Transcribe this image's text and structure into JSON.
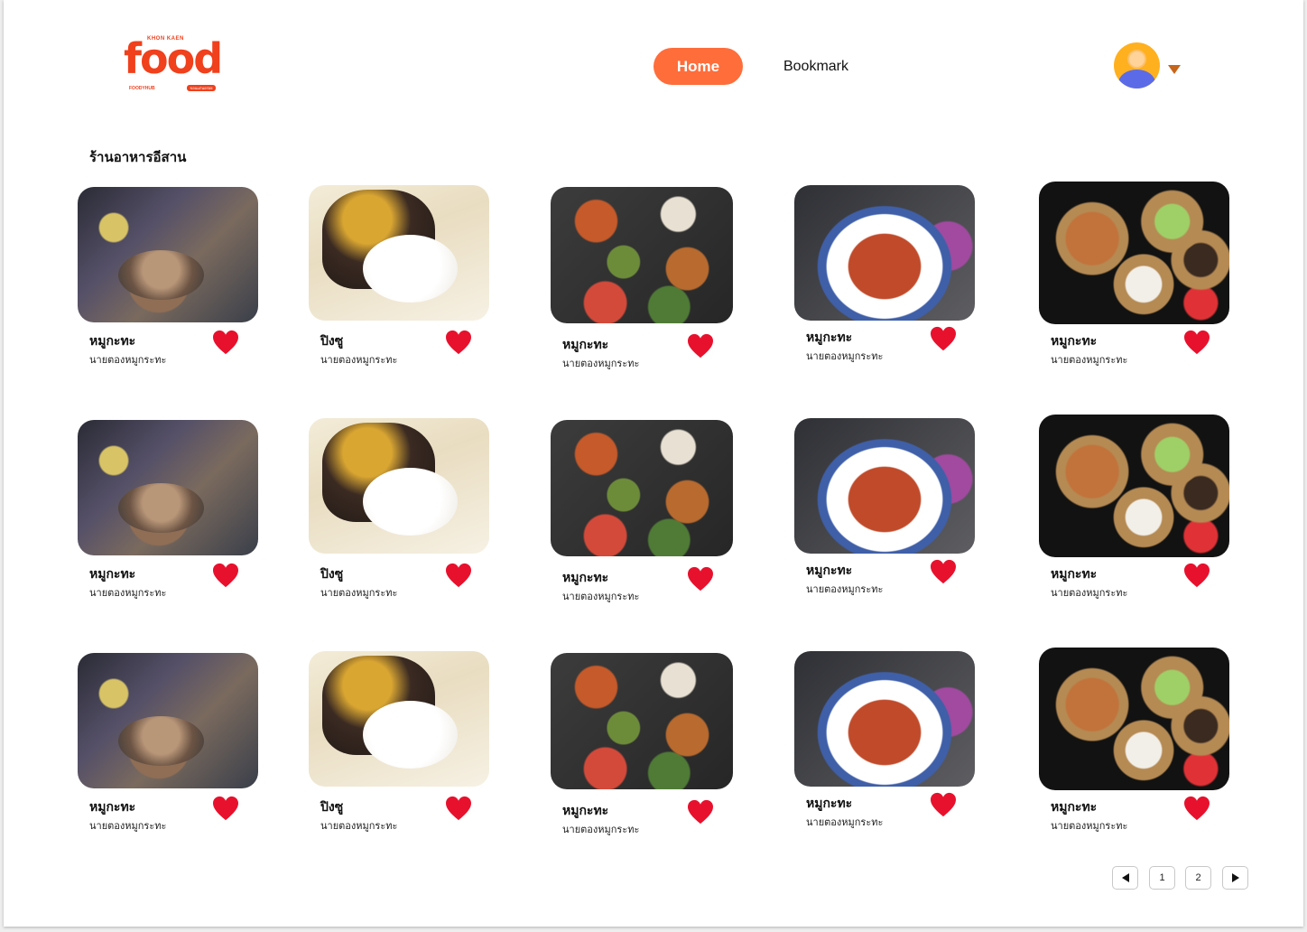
{
  "header": {
    "logo": {
      "word": "food",
      "small_top": "KHON KAEN",
      "small_bottom": "FOODYHUB",
      "tag": "ขอนแก่นอร่อย"
    },
    "nav": {
      "home_label": "Home",
      "bookmark_label": "Bookmark"
    },
    "accent_color": "#ff6d3b"
  },
  "section": {
    "title": "ร้านอาหารอีสาน"
  },
  "rows": [
    {
      "cards": [
        {
          "image": "grill-pot-photo",
          "name": "หมูกะทะ",
          "subtitle": "นายตองหมูกระทะ",
          "bookmarked": true
        },
        {
          "image": "dessert-cake-photo",
          "name": "ปิงซู",
          "subtitle": "นายตองหมูกระทะ",
          "bookmarked": true
        },
        {
          "image": "isan-dishes-photo",
          "name": "หมูกะทะ",
          "subtitle": "นายตองหมูกระทะ",
          "bookmarked": true
        },
        {
          "image": "grilled-prawns-photo",
          "name": "หมูกะทะ",
          "subtitle": "นายตองหมูกระทะ",
          "bookmarked": true
        },
        {
          "image": "bingsu-tray-photo",
          "name": "หมูกะทะ",
          "subtitle": "นายตองหมูกระทะ",
          "bookmarked": true
        }
      ]
    },
    {
      "cards": [
        {
          "image": "grill-pot-photo",
          "name": "หมูกะทะ",
          "subtitle": "นายตองหมูกระทะ",
          "bookmarked": true
        },
        {
          "image": "dessert-cake-photo",
          "name": "ปิงซู",
          "subtitle": "นายตองหมูกระทะ",
          "bookmarked": true
        },
        {
          "image": "isan-dishes-photo",
          "name": "หมูกะทะ",
          "subtitle": "นายตองหมูกระทะ",
          "bookmarked": true
        },
        {
          "image": "grilled-prawns-photo",
          "name": "หมูกะทะ",
          "subtitle": "นายตองหมูกระทะ",
          "bookmarked": true
        },
        {
          "image": "bingsu-tray-photo",
          "name": "หมูกะทะ",
          "subtitle": "นายตองหมูกระทะ",
          "bookmarked": true
        }
      ]
    },
    {
      "cards": [
        {
          "image": "grill-pot-photo",
          "name": "หมูกะทะ",
          "subtitle": "นายตองหมูกระทะ",
          "bookmarked": true
        },
        {
          "image": "dessert-cake-photo",
          "name": "ปิงซู",
          "subtitle": "นายตองหมูกระทะ",
          "bookmarked": true
        },
        {
          "image": "isan-dishes-photo",
          "name": "หมูกะทะ",
          "subtitle": "นายตองหมูกระทะ",
          "bookmarked": true
        },
        {
          "image": "grilled-prawns-photo",
          "name": "หมูกะทะ",
          "subtitle": "นายตองหมูกระทะ",
          "bookmarked": true
        },
        {
          "image": "bingsu-tray-photo",
          "name": "หมูกะทะ",
          "subtitle": "นายตองหมูกระทะ",
          "bookmarked": true
        }
      ]
    }
  ],
  "heart_color": "#e8112d",
  "pagination": {
    "prev_icon": "triangle-left-icon",
    "pages": [
      "1",
      "2"
    ],
    "next_icon": "triangle-right-icon"
  }
}
